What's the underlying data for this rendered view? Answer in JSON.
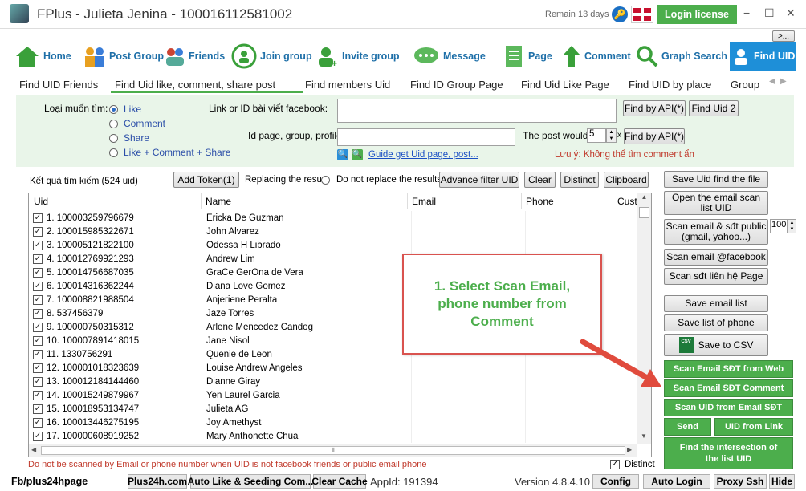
{
  "titlebar": {
    "title": "FPlus - Julieta Jenina - 100016112581002",
    "remain": "Remain 13 days",
    "login": "Login license",
    "min": "−",
    "max": "☐",
    "close": "✕",
    "more": ">..."
  },
  "nav": [
    {
      "label": "Home"
    },
    {
      "label": "Post Group"
    },
    {
      "label": "Friends"
    },
    {
      "label": "Join group"
    },
    {
      "label": "Invite group"
    },
    {
      "label": "Message"
    },
    {
      "label": "Page"
    },
    {
      "label": "Comment"
    },
    {
      "label": "Graph Search"
    },
    {
      "label": "Find UID"
    }
  ],
  "tabs": [
    "Find UID Friends",
    "Find Uid like, comment, share post",
    "Find members Uid",
    "Find ID Group Page",
    "Find Uid Like Page",
    "Find UID by place",
    "Group"
  ],
  "form": {
    "type_label": "Loại muốn tìm:",
    "options": [
      "Like",
      "Comment",
      "Share",
      "Like + Comment + Share"
    ],
    "link_label": "Link or ID bài viết facebook:",
    "idpage_label": "Id page, group, profile:",
    "post_label": "The post would li",
    "post_value": "5",
    "post_x": "x",
    "api1": "Find by API(*)",
    "finduid2": "Find Uid 2",
    "api2": "Find by API(*)",
    "guide": "Guide get Uid page, post...",
    "note": "Lưu ý: Không thể tìm comment ẩn"
  },
  "toolbar": {
    "result": "Kết quả tìm kiếm (524 uid)",
    "add_token": "Add Token(1)",
    "replacing": "Replacing the result",
    "no_replace": "Do not replace the results",
    "advance": "Advance filter UID",
    "clear": "Clear",
    "distinct": "Distinct",
    "clipboard": "Clipboard"
  },
  "table": {
    "headers": [
      "Uid",
      "Name",
      "Email",
      "Phone",
      "Custo"
    ],
    "rows": [
      {
        "uid": "1. 100003259796679",
        "name": "Ericka De Guzman"
      },
      {
        "uid": "2. 100015985322671",
        "name": "John Alvarez"
      },
      {
        "uid": "3. 100005121822100",
        "name": "Odessa H Librado"
      },
      {
        "uid": "4. 100012769921293",
        "name": "Andrew Lim"
      },
      {
        "uid": "5. 100014756687035",
        "name": "GraCe GerOna de Vera"
      },
      {
        "uid": "6. 100014316362244",
        "name": "Diana Love Gomez"
      },
      {
        "uid": "7. 100008821988504",
        "name": "Anjeriene Peralta"
      },
      {
        "uid": "8. 537456379",
        "name": "Jaze Torres"
      },
      {
        "uid": "9. 100000750315312",
        "name": "Arlene Mencedez Candog"
      },
      {
        "uid": "10. 100007891418015",
        "name": "Jane Nisol"
      },
      {
        "uid": "11. 1330756291",
        "name": "Quenie de Leon"
      },
      {
        "uid": "12. 100001018323639",
        "name": "Louise Andrew Angeles"
      },
      {
        "uid": "13. 100012184144460",
        "name": "Dianne Giray"
      },
      {
        "uid": "14. 100015249879967",
        "name": "Yen Laurel Garcia"
      },
      {
        "uid": "15. 100018953134747",
        "name": "Julieta AG"
      },
      {
        "uid": "16. 100013446275195",
        "name": "Joy Amethyst"
      },
      {
        "uid": "17. 100000608919252",
        "name": "Mary Anthonette Chua"
      }
    ]
  },
  "status": {
    "warning": "Do not be scanned by Email or phone number when UID is not facebook friends or public email phone",
    "distinct": "Distinct"
  },
  "side": {
    "save_uid": "Save Uid find the file",
    "open_email": "Open the email scan list UID",
    "scan_email_sdt": "Scan email & sđt public (gmail, yahoo...)",
    "spin": "100",
    "scan_fb": "Scan email @facebook",
    "scan_page": "Scan sđt liên hệ Page",
    "save_email": "Save email list",
    "save_phone": "Save list of phone",
    "save_csv": "Save to CSV",
    "csv_icon": "CSV",
    "g1": "Scan Email SĐT from Web",
    "g2": "Scan Email SĐT Comment",
    "g3": "Scan UID from Email SĐT",
    "g4": "Send",
    "g5": "UID from Link",
    "g6": "Find the intersection of the list UID"
  },
  "callout": {
    "text": "1. Select Scan Email, phone number from Comment"
  },
  "bottom": {
    "fb": "Fb/plus24hpage",
    "b1": "Plus24h.com",
    "b2": "Auto Like & Seeding Com...",
    "b3": "Clear Cache",
    "appid": "AppId: 191394",
    "version": "Version 4.8.4.10",
    "config": "Config",
    "autologin": "Auto Login",
    "proxy": "Proxy Ssh",
    "hide": "Hide"
  },
  "colors": {
    "accent": "#4cae4c",
    "nav_text": "#1e6fa8",
    "callout": "#d9534f",
    "arrow": "#e04b3d"
  }
}
